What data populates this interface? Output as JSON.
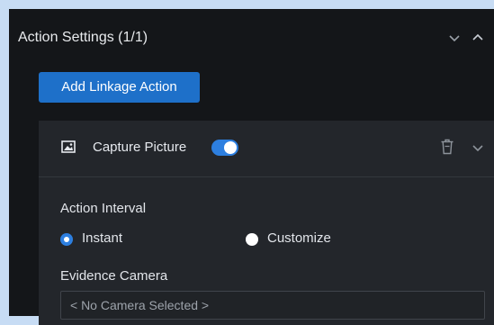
{
  "section": {
    "title": "Action Settings (1/1)",
    "collapse_icon": "chevron-down-icon",
    "expand_icon": "chevron-up-icon"
  },
  "add_button": {
    "label": "Add Linkage Action"
  },
  "action_card": {
    "icon": "image-icon",
    "title": "Capture Picture",
    "enabled": true,
    "delete_icon": "trash-icon",
    "collapse_icon": "chevron-down-icon",
    "action_interval": {
      "label": "Action Interval",
      "options": [
        {
          "label": "Instant",
          "selected": true
        },
        {
          "label": "Customize",
          "selected": false
        }
      ]
    },
    "evidence_camera": {
      "label": "Evidence Camera",
      "value": "< No Camera Selected >"
    }
  },
  "colors": {
    "page_bg": "#c7dcf4",
    "panel_bg": "#141619",
    "card_bg": "#23262b",
    "accent": "#1e70c9",
    "toggle_on": "#2d7fe0"
  }
}
